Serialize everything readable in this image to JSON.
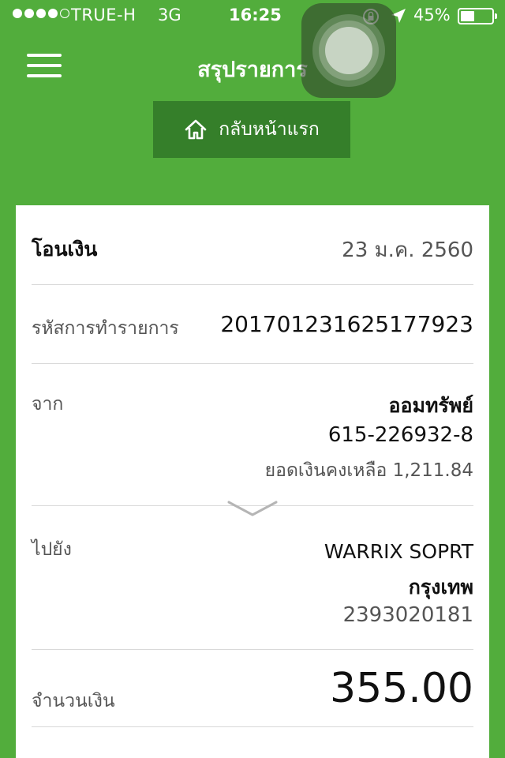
{
  "status_bar": {
    "carrier": "TRUE-H",
    "network": "3G",
    "time": "16:25",
    "battery_percent": "45%",
    "battery_level": 0.45,
    "signal_bars_filled": 4,
    "signal_bars_total": 5
  },
  "nav": {
    "title": "สรุปรายการ",
    "menu_icon": "hamburger-menu-icon"
  },
  "home_button": {
    "label": "กลับหน้าแรก",
    "icon": "home-icon"
  },
  "summary": {
    "type_label": "โอนเงิน",
    "date": "23 ม.ค. 2560",
    "ref_label": "รหัสการทำรายการ",
    "ref_value": "201701231625177923",
    "from_label": "จาก",
    "from_account_name": "ออมทรัพย์",
    "from_account_number": "615-226932-8",
    "from_balance": "ยอดเงินคงเหลือ 1,211.84",
    "to_label": "ไปยัง",
    "to_name": "WARRIX SOPRT",
    "to_bank": "กรุงเทพ",
    "to_account_number": "2393020181",
    "amount_label": "จำนวนเงิน",
    "amount_value": "355.00"
  },
  "colors": {
    "brand_green": "#52ad3c",
    "button_green": "#357f2a"
  }
}
